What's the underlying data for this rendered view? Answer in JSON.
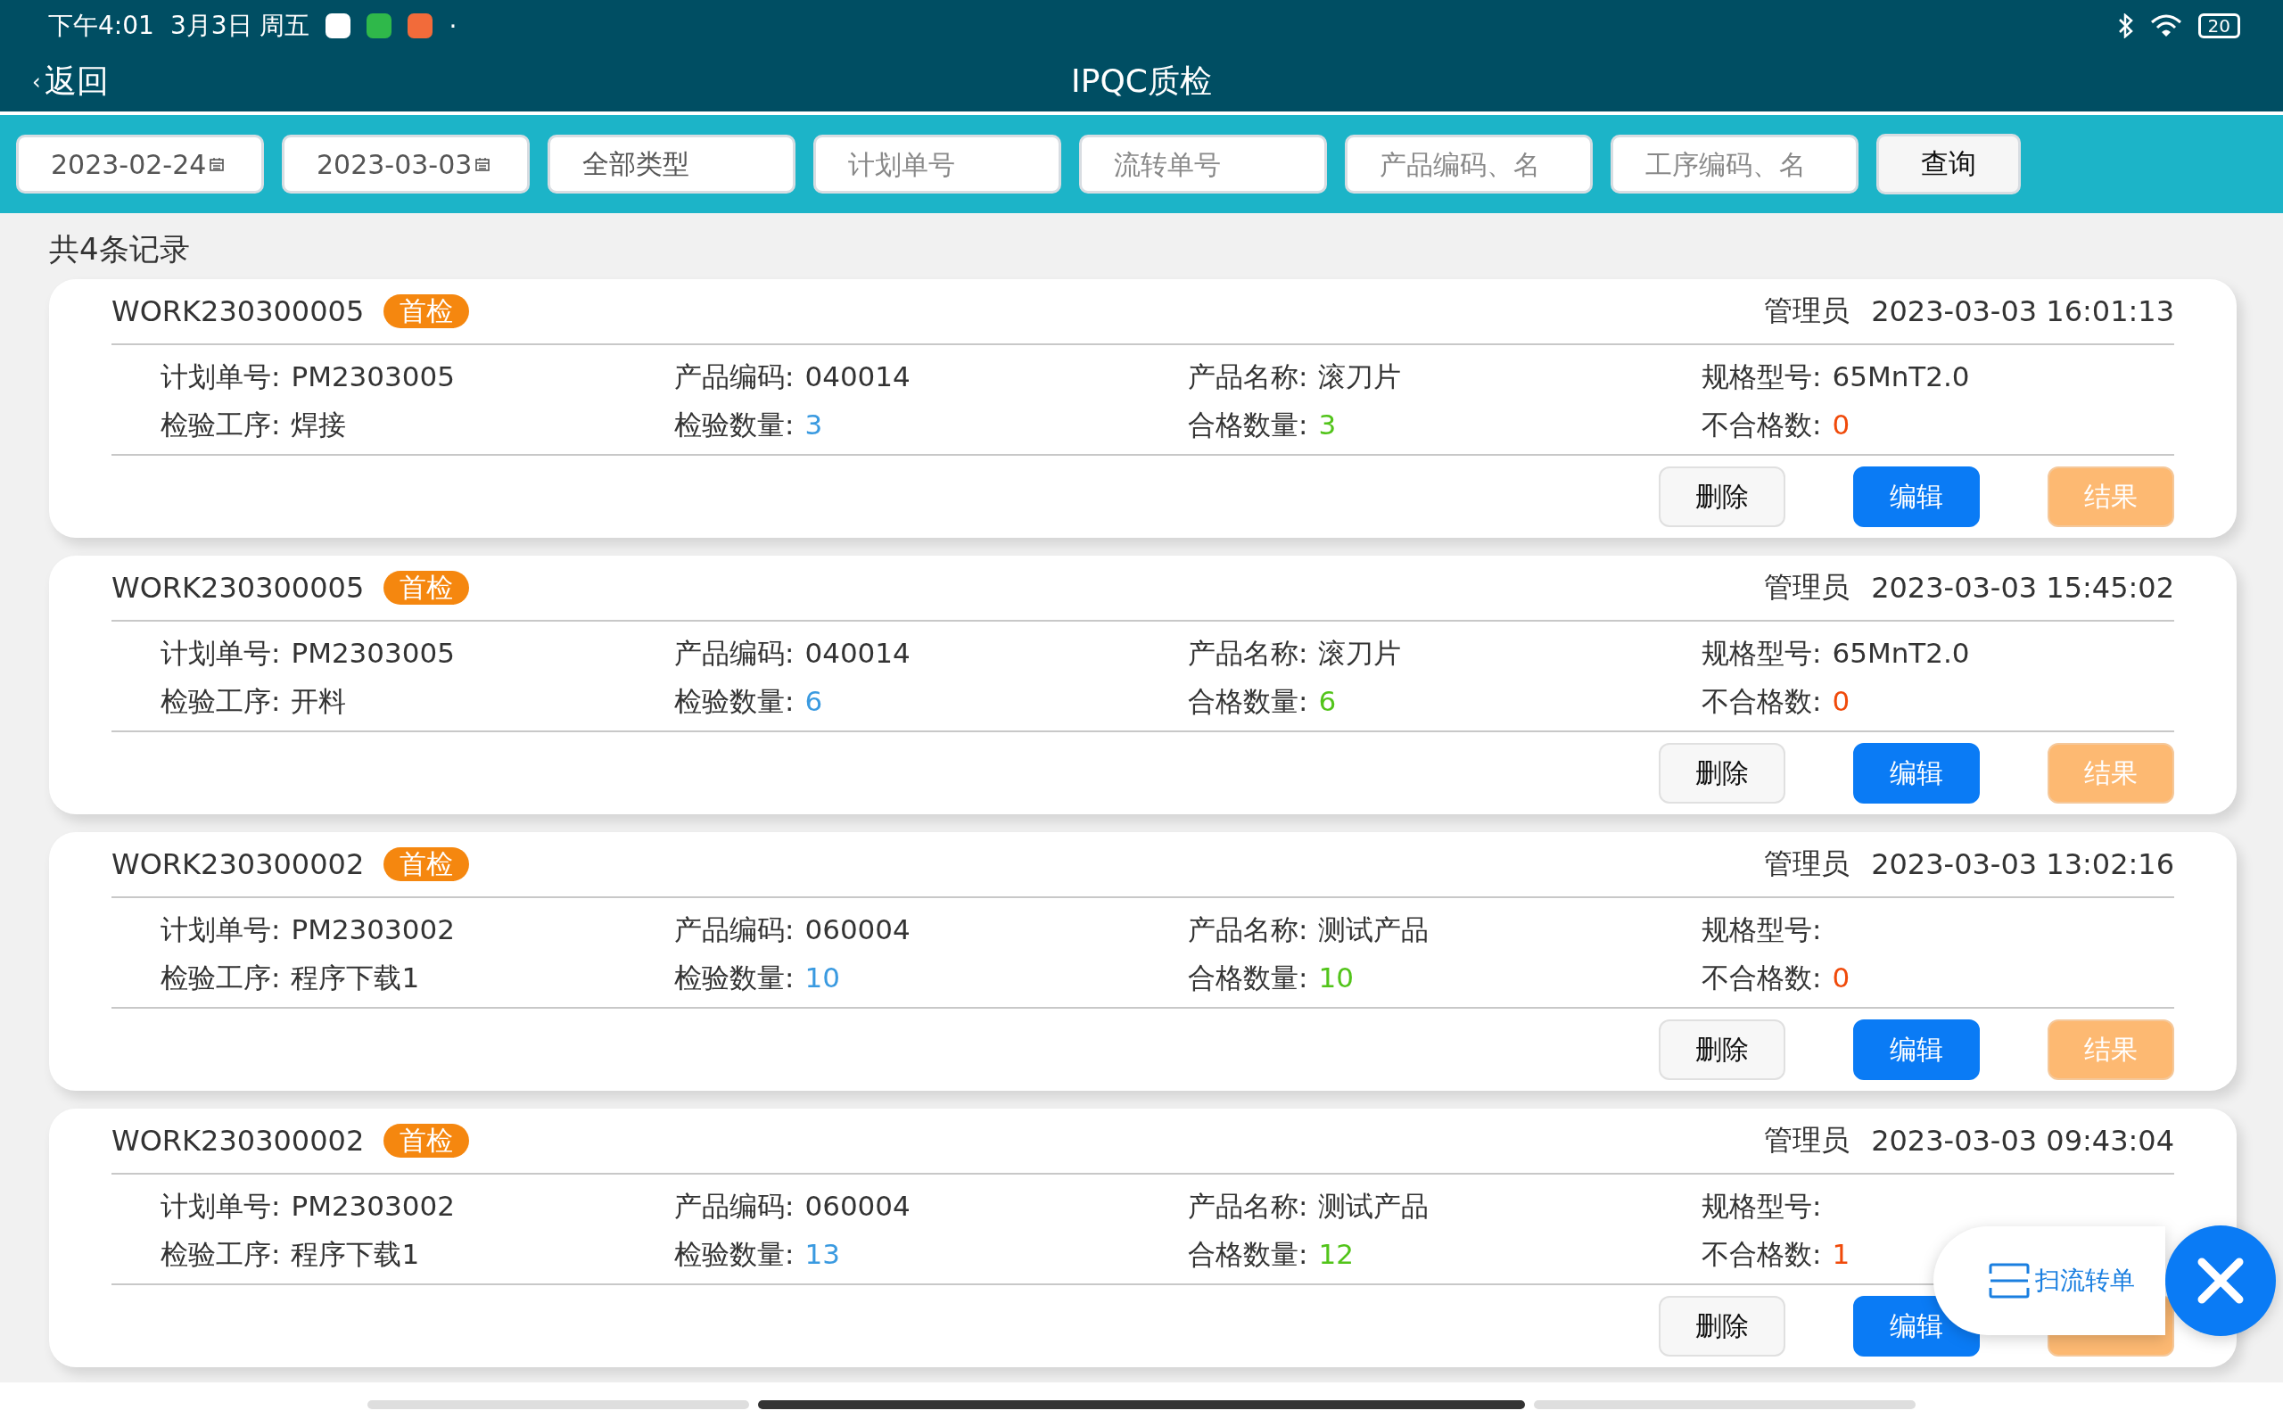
{
  "status_bar": {
    "time": "下午4:01",
    "date": "3月3日 周五",
    "app_icons": [
      {
        "color": "#ffffff"
      },
      {
        "color": "#2fb84a"
      },
      {
        "color": "#f26b3a"
      }
    ],
    "dot": "·",
    "battery": "20"
  },
  "header": {
    "back": "返回",
    "back_glyph": "‹",
    "title": "IPQC质检"
  },
  "filters": [
    {
      "kind": "date",
      "value": "2023-02-24"
    },
    {
      "kind": "date",
      "value": "2023-03-03"
    },
    {
      "kind": "select",
      "value": "全部类型"
    },
    {
      "kind": "text",
      "placeholder": "计划单号"
    },
    {
      "kind": "text",
      "placeholder": "流转单号"
    },
    {
      "kind": "text",
      "placeholder": "产品编码、名"
    },
    {
      "kind": "text",
      "placeholder": "工序编码、名"
    }
  ],
  "query_button": "查询",
  "record_count": "共4条记录",
  "records": [
    {
      "code": "WORK230300005",
      "badge": "首检",
      "user": "管理员",
      "time": "2023-03-03 16:01:13",
      "fields": [
        {
          "label": "计划单号:",
          "value": "PM2303005",
          "kind": "plain"
        },
        {
          "label": "产品编码:",
          "value": "040014",
          "kind": "plain"
        },
        {
          "label": "产品名称:",
          "value": "滚刀片",
          "kind": "plain"
        },
        {
          "label": "规格型号:",
          "value": "65MnT2.0",
          "kind": "plain"
        },
        {
          "label": "检验工序:",
          "value": "焊接",
          "kind": "plain"
        },
        {
          "label": "检验数量:",
          "value": "3",
          "kind": "count"
        },
        {
          "label": "合格数量:",
          "value": "3",
          "kind": "pass"
        },
        {
          "label": "不合格数:",
          "value": "0",
          "kind": "fail"
        }
      ],
      "buttons": [
        {
          "kind": "delete",
          "label": "删除"
        },
        {
          "kind": "edit",
          "label": "编辑"
        },
        {
          "kind": "result",
          "label": "结果"
        }
      ]
    },
    {
      "code": "WORK230300005",
      "badge": "首检",
      "user": "管理员",
      "time": "2023-03-03 15:45:02",
      "fields": [
        {
          "label": "计划单号:",
          "value": "PM2303005",
          "kind": "plain"
        },
        {
          "label": "产品编码:",
          "value": "040014",
          "kind": "plain"
        },
        {
          "label": "产品名称:",
          "value": "滚刀片",
          "kind": "plain"
        },
        {
          "label": "规格型号:",
          "value": "65MnT2.0",
          "kind": "plain"
        },
        {
          "label": "检验工序:",
          "value": "开料",
          "kind": "plain"
        },
        {
          "label": "检验数量:",
          "value": "6",
          "kind": "count"
        },
        {
          "label": "合格数量:",
          "value": "6",
          "kind": "pass"
        },
        {
          "label": "不合格数:",
          "value": "0",
          "kind": "fail"
        }
      ],
      "buttons": [
        {
          "kind": "delete",
          "label": "删除"
        },
        {
          "kind": "edit",
          "label": "编辑"
        },
        {
          "kind": "result",
          "label": "结果"
        }
      ]
    },
    {
      "code": "WORK230300002",
      "badge": "首检",
      "user": "管理员",
      "time": "2023-03-03 13:02:16",
      "fields": [
        {
          "label": "计划单号:",
          "value": "PM2303002",
          "kind": "plain"
        },
        {
          "label": "产品编码:",
          "value": "060004",
          "kind": "plain"
        },
        {
          "label": "产品名称:",
          "value": "测试产品",
          "kind": "plain"
        },
        {
          "label": "规格型号:"
        },
        {
          "label": "检验工序:",
          "value": "程序下载1",
          "kind": "plain"
        },
        {
          "label": "检验数量:",
          "value": "10",
          "kind": "count"
        },
        {
          "label": "合格数量:",
          "value": "10",
          "kind": "pass"
        },
        {
          "label": "不合格数:",
          "value": "0",
          "kind": "fail"
        }
      ],
      "buttons": [
        {
          "kind": "delete",
          "label": "删除"
        },
        {
          "kind": "edit",
          "label": "编辑"
        },
        {
          "kind": "result",
          "label": "结果"
        }
      ]
    },
    {
      "code": "WORK230300002",
      "badge": "首检",
      "user": "管理员",
      "time": "2023-03-03 09:43:04",
      "fields": [
        {
          "label": "计划单号:",
          "value": "PM2303002",
          "kind": "plain"
        },
        {
          "label": "产品编码:",
          "value": "060004",
          "kind": "plain"
        },
        {
          "label": "产品名称:",
          "value": "测试产品",
          "kind": "plain"
        },
        {
          "label": "规格型号:"
        },
        {
          "label": "检验工序:",
          "value": "程序下载1",
          "kind": "plain"
        },
        {
          "label": "检验数量:",
          "value": "13",
          "kind": "count"
        },
        {
          "label": "合格数量:",
          "value": "12",
          "kind": "pass"
        },
        {
          "label": "不合格数:",
          "value": "1",
          "kind": "fail"
        }
      ],
      "buttons": [
        {
          "kind": "delete",
          "label": "删除"
        },
        {
          "kind": "edit",
          "label": "编辑"
        },
        {
          "kind": "result"
        }
      ]
    }
  ],
  "scan_button": "扫流转单"
}
